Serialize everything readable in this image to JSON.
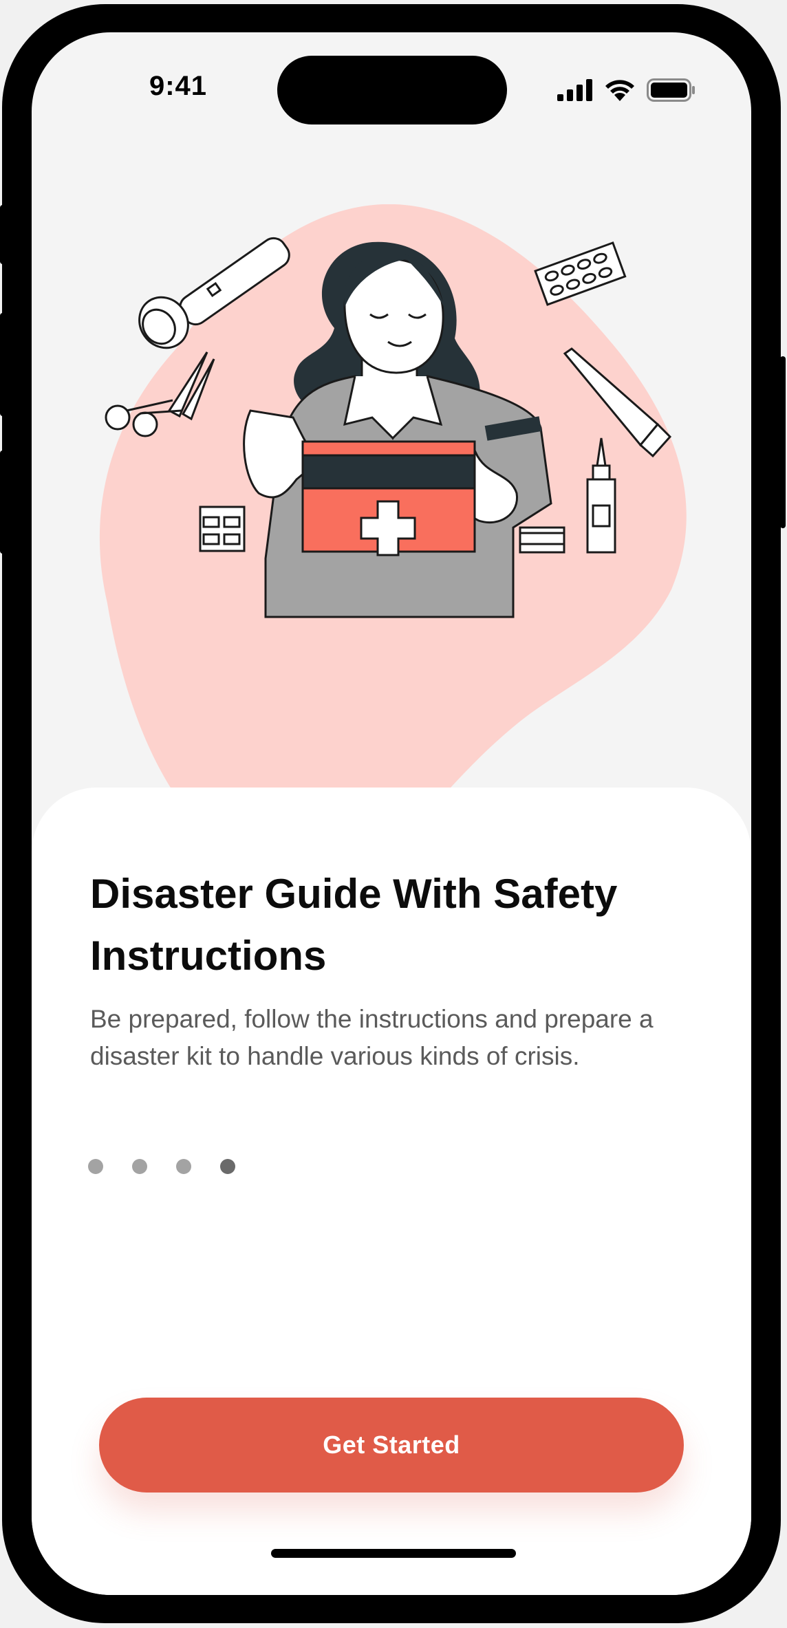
{
  "status_bar": {
    "time": "9:41",
    "icons": [
      "cellular-signal-icon",
      "wifi-icon",
      "battery-icon"
    ]
  },
  "illustration": {
    "subject": "woman-with-first-aid-kit",
    "icons": [
      "flashlight-icon",
      "pill-pack-icon",
      "scissors-icon",
      "ointment-tube-icon",
      "first-aid-kit-icon",
      "bandage-box-icon",
      "medicine-bottle-icon",
      "dropper-bottle-icon"
    ],
    "colors": {
      "blob": "#fdd2cd",
      "kit": "#f96f5d",
      "shirt": "#a3a3a3",
      "hair": "#263238"
    }
  },
  "onboarding": {
    "title": "Disaster Guide With Safety Instructions",
    "subtitle": "Be prepared, follow the instructions and prepare a disaster kit to handle various kinds of crisis.",
    "page_count": 4,
    "active_page": 4,
    "cta_label": "Get Started"
  },
  "colors": {
    "accent": "#e05b48",
    "background": "#f4f4f4",
    "sheet": "#ffffff"
  }
}
